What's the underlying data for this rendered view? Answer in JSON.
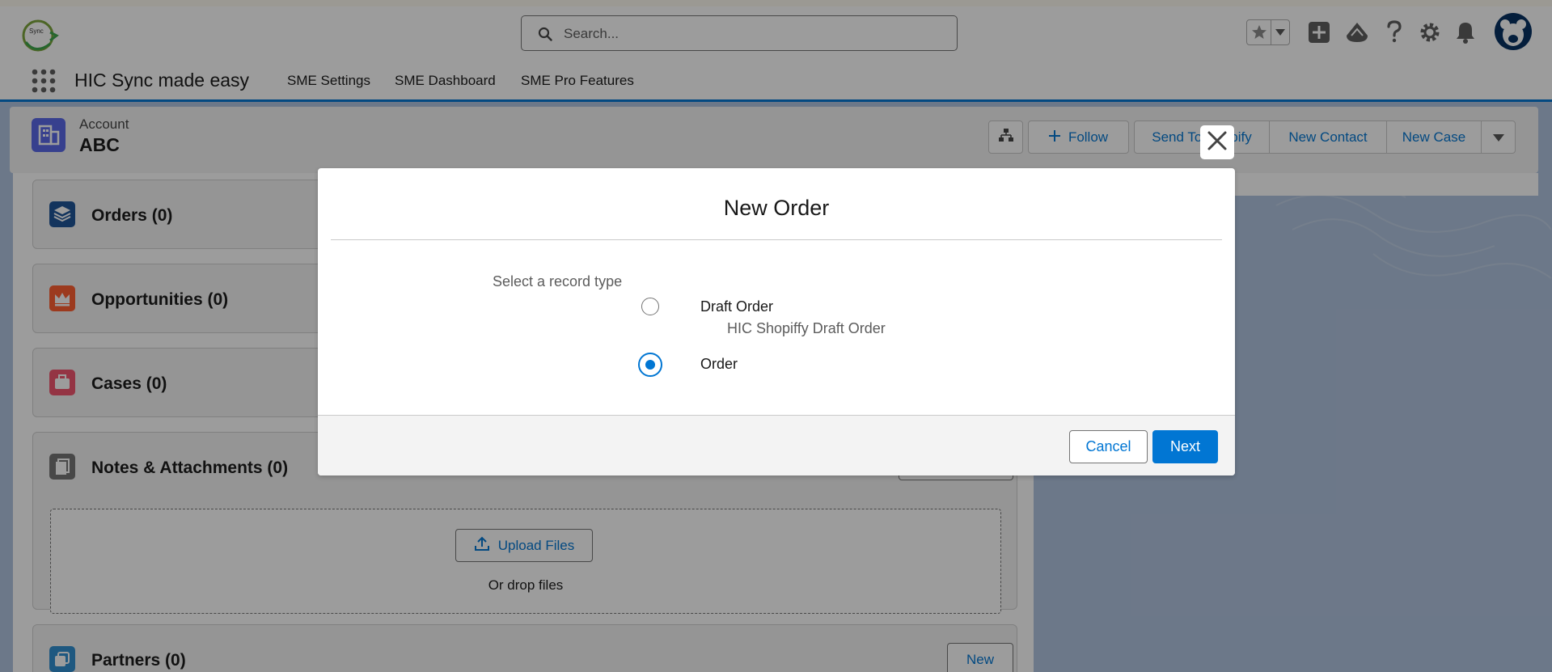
{
  "app": {
    "name": "HIC Sync made easy",
    "logo_text": "Sync"
  },
  "search": {
    "placeholder": "Search..."
  },
  "nav": {
    "items": [
      "SME Settings",
      "SME Dashboard",
      "SME Pro Features"
    ]
  },
  "header_icons": [
    "favorites-star-icon",
    "add-icon",
    "trailhead-icon",
    "help-icon",
    "setup-gear-icon",
    "notifications-bell-icon",
    "user-avatar"
  ],
  "record": {
    "object_label": "Account",
    "name": "ABC",
    "actions": {
      "follow": "Follow",
      "send_to_shopify": "Send To Shopify",
      "new_contact": "New Contact",
      "new_case": "New Case"
    }
  },
  "related_lists": {
    "orders": "Orders (0)",
    "opportunities": "Opportunities (0)",
    "cases": "Cases (0)",
    "notes": "Notes & Attachments (0)",
    "upload_files": "Upload Files",
    "drop_files": "Or drop files",
    "partners": "Partners (0)",
    "partners_new": "New"
  },
  "modal": {
    "title": "New Order",
    "prompt": "Select a record type",
    "options": [
      {
        "label": "Draft Order",
        "description": "HIC Shopiffy Draft Order",
        "selected": false
      },
      {
        "label": "Order",
        "description": "",
        "selected": true
      }
    ],
    "cancel": "Cancel",
    "next": "Next"
  },
  "colors": {
    "brand": "#0176d3",
    "account_icon": "#5867e8",
    "orders_icon": "#1b5297",
    "opportunities_icon": "#ff5d2d",
    "cases_icon": "#f2536d",
    "notes_icon": "#747474",
    "partners_icon": "#2e8ed1"
  }
}
